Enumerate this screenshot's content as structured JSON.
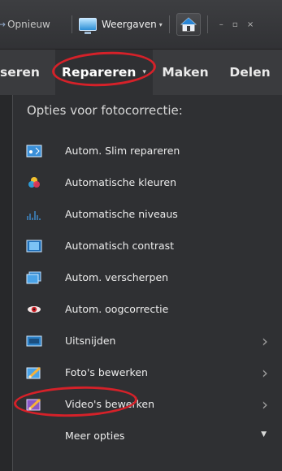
{
  "toolbar": {
    "undo_label": "Opnieuw",
    "views_label": "Weergaven",
    "home_icon": "home-icon",
    "window_controls": "– ▫ ×"
  },
  "tabs": {
    "prev_partial": "seren",
    "active": "Repareren",
    "make": "Maken",
    "share": "Delen"
  },
  "panel": {
    "title": "Opties voor fotocorrectie:",
    "items": [
      {
        "label": "Autom. Slim repareren",
        "icon": "smart-fix-icon"
      },
      {
        "label": "Automatische kleuren",
        "icon": "color-icon"
      },
      {
        "label": "Automatische niveaus",
        "icon": "levels-icon"
      },
      {
        "label": "Automatisch contrast",
        "icon": "contrast-icon"
      },
      {
        "label": "Autom. verscherpen",
        "icon": "sharpen-icon"
      },
      {
        "label": "Autom. oogcorrectie",
        "icon": "red-eye-icon"
      },
      {
        "label": "Uitsnijden",
        "icon": "crop-icon",
        "submenu": true
      },
      {
        "label": "Foto's bewerken",
        "icon": "edit-photo-icon",
        "submenu": true
      },
      {
        "label": "Video's bewerken",
        "icon": "edit-video-icon",
        "submenu": true
      },
      {
        "label": "Meer opties",
        "icon": "",
        "dropdown": true
      }
    ]
  },
  "colors": {
    "background": "#2f3033",
    "highlight": "#d52129"
  }
}
